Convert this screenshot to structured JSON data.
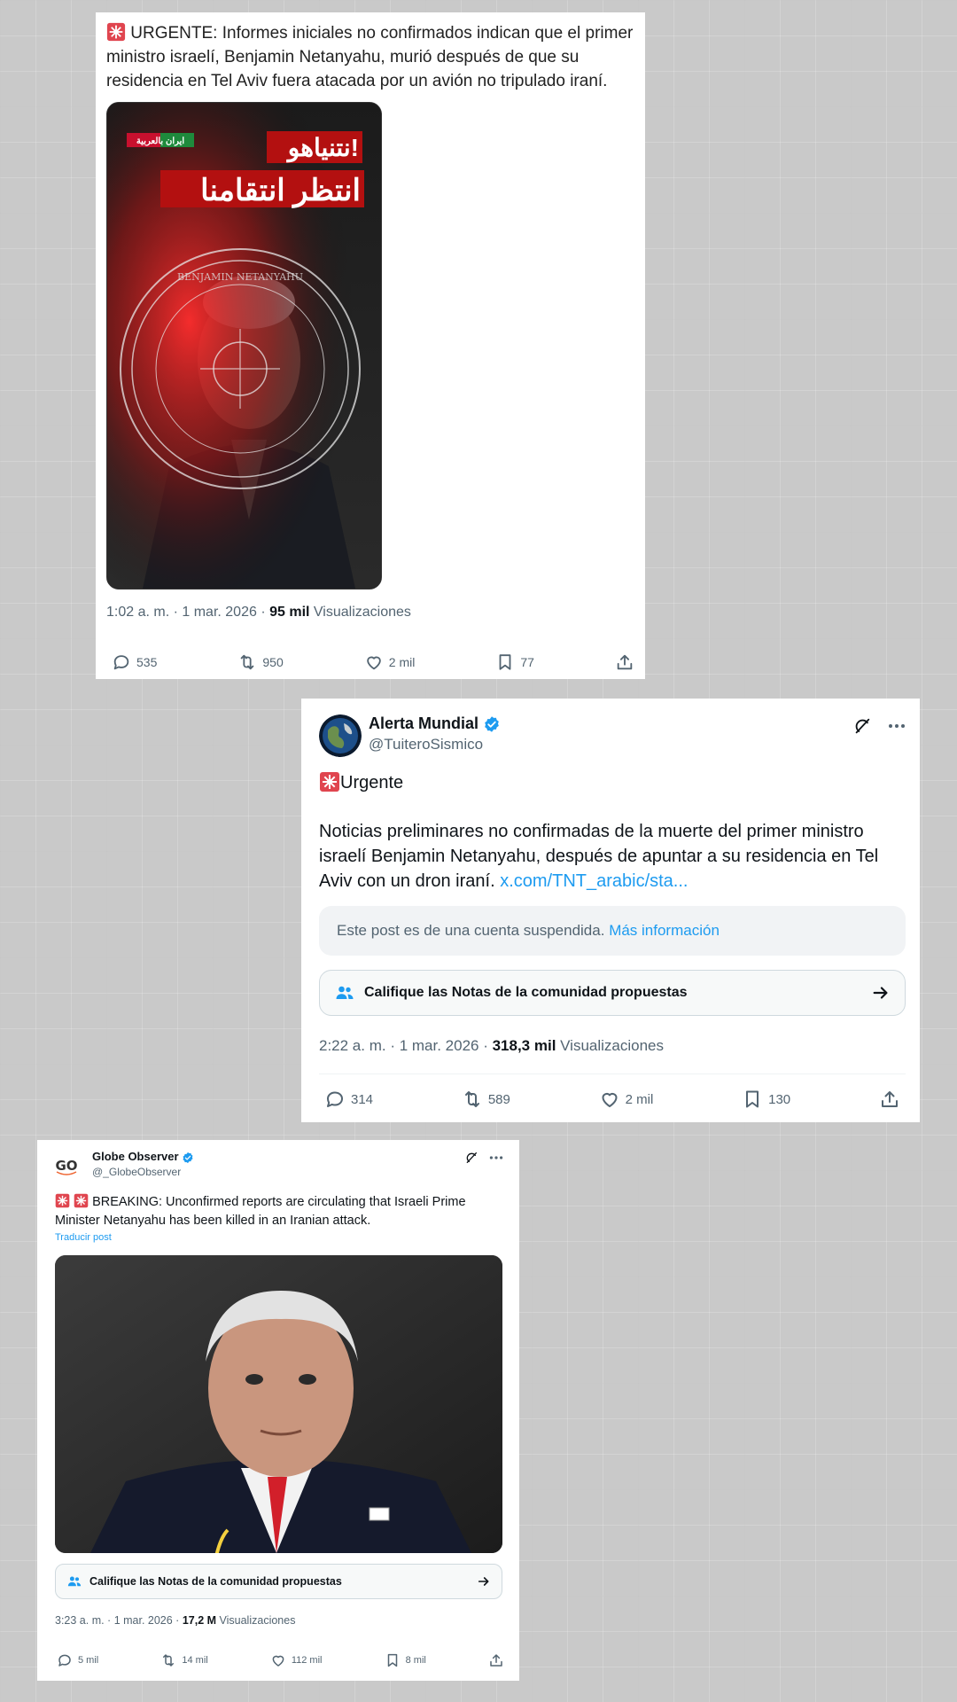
{
  "colors": {
    "link": "#1d9bf0",
    "muted": "#536471",
    "verified": "#1d9bf0",
    "background": "#c9c9c9"
  },
  "post1": {
    "siren_icon": "rotating-light-emoji",
    "text": "URGENTE: Informes iniciales no confirmados indican que el primer ministro israelí, Benjamin Netanyahu, murió después de que su residencia en Tel Aviv fuera atacada por un avión no tripulado iraní.",
    "image": {
      "logo_text": "ایران بالعربية",
      "headline_line1": "نتنیاهو!",
      "headline_line2": "انتظر انتقامنا",
      "stamp_text": "BENJAMIN NETANYAHU"
    },
    "time": "1:02 a. m. · 1 mar. 2026 · ",
    "views_count": "95 mil",
    "views_label": " Visualizaciones",
    "replies": "535",
    "reposts": "950",
    "likes": "2 mil",
    "bookmarks": "77"
  },
  "post2": {
    "author_name": "Alerta Mundial",
    "handle": "@TuiteroSismico",
    "title": "Urgente",
    "body": "Noticias preliminares no confirmadas de la muerte del primer ministro israelí Benjamin Netanyahu, después de apuntar a su residencia en Tel Aviv con un dron iraní. ",
    "link": "x.com/TNT_arabic/sta...",
    "suspended_text": "Este post es de una cuenta suspendida. ",
    "suspended_link": "Más información",
    "notes_label": "Califique las Notas de la comunidad propuestas",
    "time": "2:22 a. m. · 1 mar. 2026 · ",
    "views_count": "318,3 mil",
    "views_label": " Visualizaciones",
    "replies": "314",
    "reposts": "589",
    "likes": "2 mil",
    "bookmarks": "130"
  },
  "post3": {
    "author_name": "Globe Observer",
    "handle": "@_GlobeObserver",
    "avatar_text": "GO",
    "text": "BREAKING: Unconfirmed reports are circulating that Israeli Prime Minister Netanyahu has been killed in an Iranian attack.",
    "translate": "Traducir post",
    "notes_label": "Califique las Notas de la comunidad propuestas",
    "time": "3:23 a. m. · 1 mar. 2026 · ",
    "views_count": "17,2 M",
    "views_label": " Visualizaciones",
    "replies": "5 mil",
    "reposts": "14 mil",
    "likes": "112 mil",
    "bookmarks": "8 mil"
  }
}
